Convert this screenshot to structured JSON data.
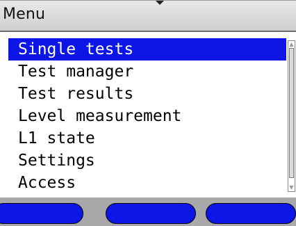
{
  "header": {
    "title": "Menu"
  },
  "menu": {
    "selected_index": 0,
    "items": [
      {
        "label": "Single tests"
      },
      {
        "label": "Test manager"
      },
      {
        "label": "Test results"
      },
      {
        "label": "Level measurement"
      },
      {
        "label": "L1 state"
      },
      {
        "label": "Settings"
      },
      {
        "label": "Access"
      }
    ]
  },
  "scrollbar": {
    "up_icon": "scroll-up-arrow",
    "down_icon": "scroll-down-arrow"
  },
  "softkeys": [
    {
      "label": ""
    },
    {
      "label": ""
    },
    {
      "label": ""
    }
  ],
  "colors": {
    "selection": "#0c16e6",
    "softkey": "#0c16e6",
    "softkey_bar": "#a9a9a9",
    "title_bar": "#d9d9d9"
  }
}
